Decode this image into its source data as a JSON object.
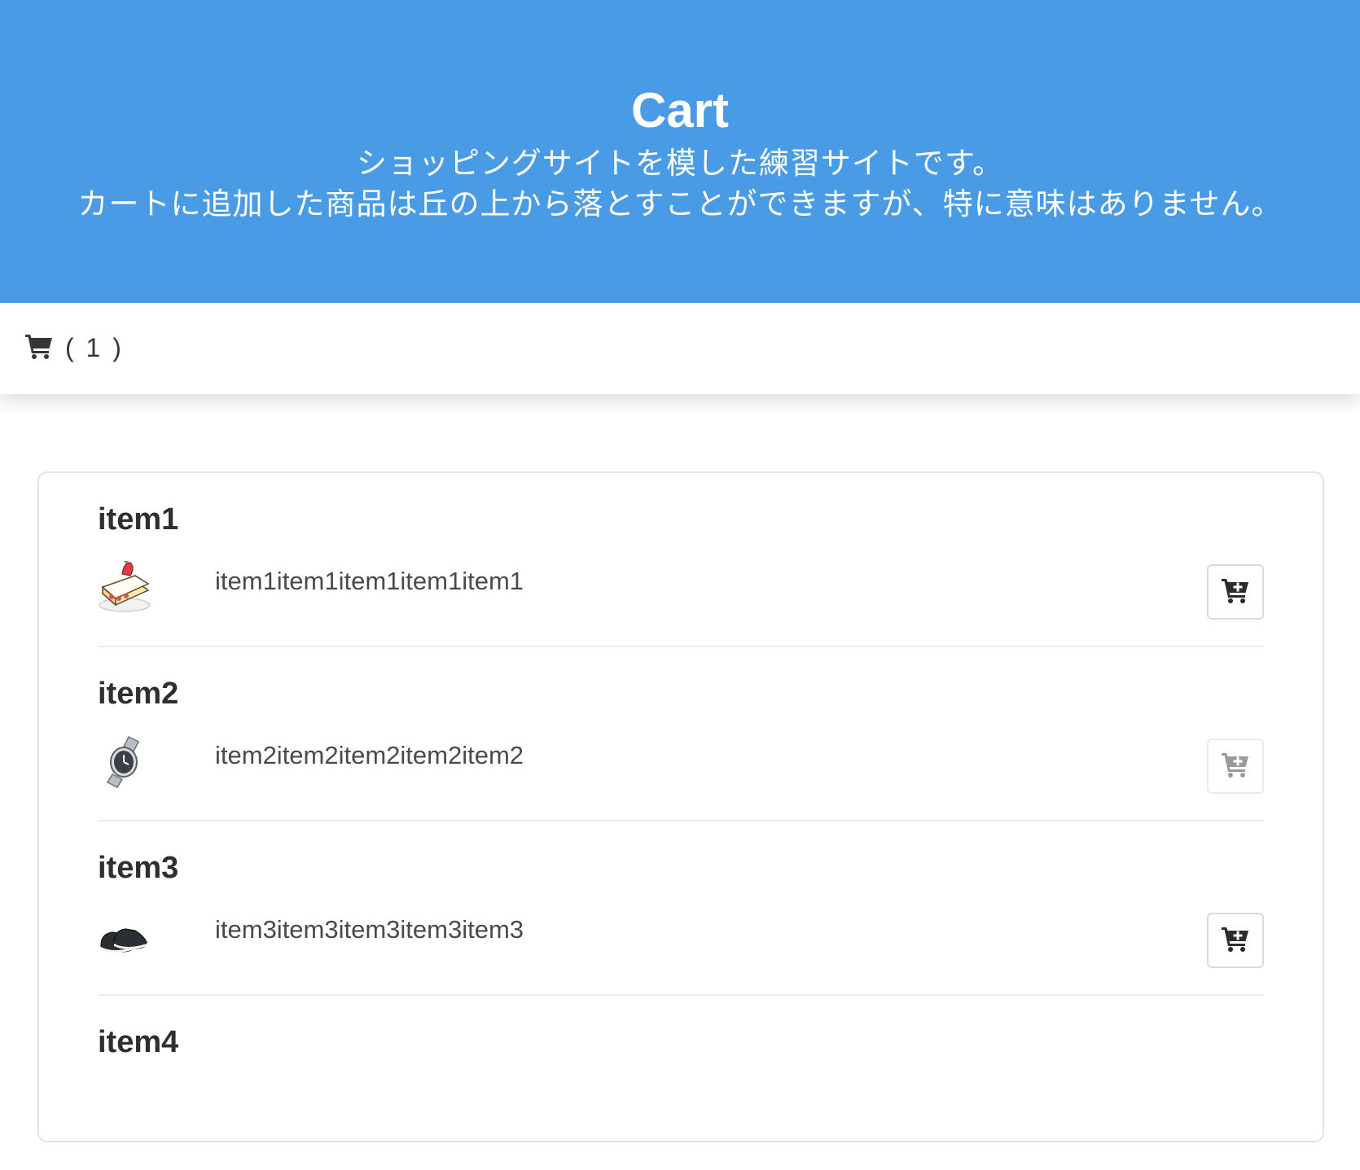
{
  "hero": {
    "title": "Cart",
    "subtitle_line1": "ショッピングサイトを模した練習サイトです。",
    "subtitle_line2": "カートに追加した商品は丘の上から落とすことができますが、特に意味はありません。",
    "background_color": "#4a9be6"
  },
  "navbar": {
    "cart_icon": "shopping-cart-icon",
    "cart_count": "( 1 )"
  },
  "items": [
    {
      "name": "item1",
      "description": "item1item1item1item1item1",
      "thumbnail": "strawberry-shortcake-image",
      "button_icon": "cart-plus-icon",
      "button_disabled": false
    },
    {
      "name": "item2",
      "description": "item2item2item2item2item2",
      "thumbnail": "wristwatch-image",
      "button_icon": "cart-plus-icon",
      "button_disabled": true
    },
    {
      "name": "item3",
      "description": "item3item3item3item3item3",
      "thumbnail": "slip-on-shoes-image",
      "button_icon": "cart-plus-icon",
      "button_disabled": false
    },
    {
      "name": "item4",
      "description": "",
      "thumbnail": "",
      "button_icon": "cart-plus-icon",
      "button_disabled": false
    }
  ]
}
